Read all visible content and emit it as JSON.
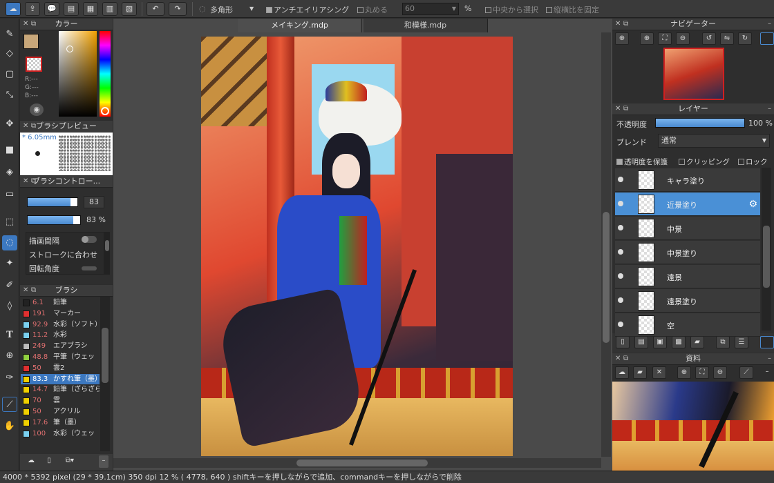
{
  "toolbar": {
    "shape": "多角形",
    "antialias": "アンチエイリアシング",
    "round": "丸める",
    "round_value": "60",
    "percent": "%",
    "from_center": "中央から選択",
    "fix_ratio": "縦横比を固定"
  },
  "panels": {
    "color": "カラー",
    "brush_preview": "ブラシプレビュー",
    "brush_control": "ブラシコントロー...",
    "brush": "ブラシ",
    "navigator": "ナビゲーター",
    "layer": "レイヤー",
    "material": "資料"
  },
  "color": {
    "r": "R:---",
    "g": "G:---",
    "b": "B:---"
  },
  "brush_preview": {
    "size": "* 6.05mm"
  },
  "brush_control": {
    "size_value": "83",
    "opacity_value": "83 %",
    "spacing": "描画間隔",
    "stroke": "ストロークに合わせ",
    "rotation": "回転角度"
  },
  "brushes": [
    {
      "size": "6.1",
      "name": "鉛筆",
      "color": "#222222"
    },
    {
      "size": "191",
      "name": "マーカー",
      "color": "#e03030"
    },
    {
      "size": "92.9",
      "name": "水彩（ソフト）",
      "color": "#7ad0f0"
    },
    {
      "size": "11.2",
      "name": "水彩",
      "color": "#7ad0f0"
    },
    {
      "size": "249",
      "name": "エアブラシ",
      "color": "#bbbbbb"
    },
    {
      "size": "48.8",
      "name": "平筆（ウェッ",
      "color": "#90d040"
    },
    {
      "size": "50",
      "name": "雲2",
      "color": "#e03030"
    },
    {
      "size": "83.3",
      "name": "かすれ筆（墨）",
      "color": "#f0d000"
    },
    {
      "size": "14.7",
      "name": "鉛筆（ざらざら）",
      "color": "#f0d000"
    },
    {
      "size": "70",
      "name": "雲",
      "color": "#f0d000"
    },
    {
      "size": "50",
      "name": "アクリル",
      "color": "#f0d000"
    },
    {
      "size": "17.6",
      "name": "筆（墨）",
      "color": "#f0d000"
    },
    {
      "size": "100",
      "name": "水彩（ウェッ",
      "color": "#7ad0f0"
    }
  ],
  "tabs": [
    {
      "label": "メイキング.mdp"
    },
    {
      "label": "和模様.mdp"
    }
  ],
  "layer_panel": {
    "opacity_label": "不透明度",
    "opacity_value": "100 %",
    "opacity_level": 1.0,
    "blend_label": "ブレンド",
    "blend_value": "通常",
    "protect": "透明度を保護",
    "clipping": "クリッピング",
    "lock": "ロック",
    "layers": [
      {
        "name": "キャラ塗り"
      },
      {
        "name": "近景塗り"
      },
      {
        "name": "中景"
      },
      {
        "name": "中景塗り"
      },
      {
        "name": "遠景"
      },
      {
        "name": "遠景塗り"
      },
      {
        "name": "空"
      }
    ]
  },
  "status": "4000 * 5392 pixel  (29 * 39.1cm)  350 dpi  12 %  ( 4778, 640 )  shiftキーを押しながらで追加、commandキーを押しながらで削除"
}
